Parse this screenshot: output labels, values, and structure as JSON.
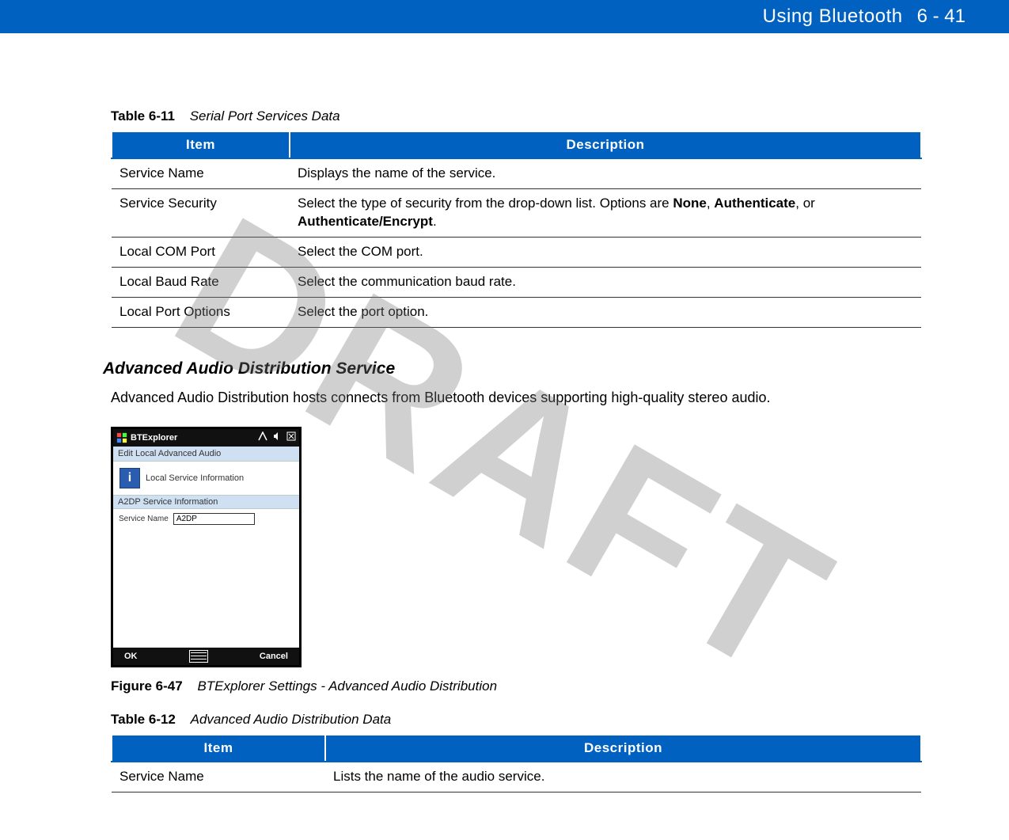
{
  "header": {
    "chapter_title": "Using Bluetooth",
    "page_number": "6 - 41"
  },
  "watermark": "DRAFT",
  "table611": {
    "label": "Table 6-11",
    "title": "Serial Port Services Data",
    "columns": {
      "item": "Item",
      "desc": "Description"
    },
    "rows": [
      {
        "item": "Service Name",
        "desc": "Displays the name of the service."
      },
      {
        "item": "Service Security",
        "desc": "Select the type of security from the drop-down list. Options are <b>None</b>, <b>Authenticate</b>, or <b>Authenticate/Encrypt</b>."
      },
      {
        "item": "Local COM Port",
        "desc": "Select the COM port."
      },
      {
        "item": "Local Baud Rate",
        "desc": "Select the communication baud rate."
      },
      {
        "item": "Local Port Options",
        "desc": "Select the port option."
      }
    ]
  },
  "section": {
    "title": "Advanced Audio Distribution Service",
    "body": "Advanced Audio Distribution hosts connects from Bluetooth devices supporting high-quality stereo audio."
  },
  "screenshot": {
    "app_title": "BTExplorer",
    "panel_title": "Edit Local Advanced Audio",
    "info_label": "Local Service Information",
    "sub_header": "A2DP Service Information",
    "field_label": "Service Name",
    "field_value": "A2DP",
    "ok": "OK",
    "cancel": "Cancel"
  },
  "figure647": {
    "label": "Figure 6-47",
    "title": "BTExplorer Settings - Advanced Audio Distribution"
  },
  "table612": {
    "label": "Table 6-12",
    "title": "Advanced Audio Distribution Data",
    "columns": {
      "item": "Item",
      "desc": "Description"
    },
    "rows": [
      {
        "item": "Service Name",
        "desc": "Lists the name of the audio service."
      }
    ]
  }
}
